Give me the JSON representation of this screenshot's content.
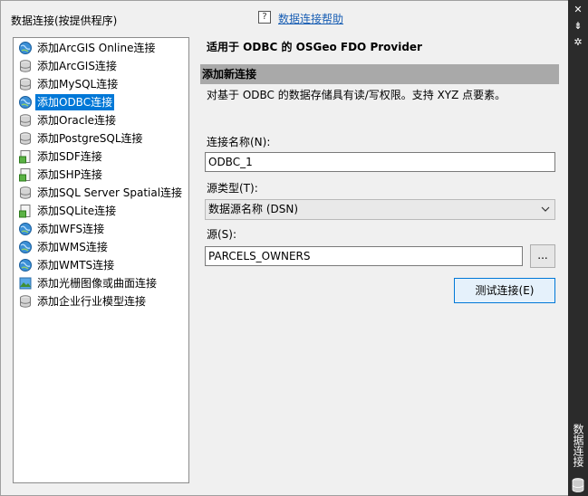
{
  "header": {
    "panel_title": "数据连接(按提供程序)",
    "help_icon": "?",
    "help_link": "数据连接帮助"
  },
  "providers": [
    {
      "label": "添加ArcGIS Online连接",
      "icon": "globe-icon"
    },
    {
      "label": "添加ArcGIS连接",
      "icon": "database-icon"
    },
    {
      "label": "添加MySQL连接",
      "icon": "database-icon"
    },
    {
      "label": "添加ODBC连接",
      "icon": "globe-icon",
      "selected": true
    },
    {
      "label": "添加Oracle连接",
      "icon": "database-icon"
    },
    {
      "label": "添加PostgreSQL连接",
      "icon": "database-icon"
    },
    {
      "label": "添加SDF连接",
      "icon": "file-icon"
    },
    {
      "label": "添加SHP连接",
      "icon": "file-icon"
    },
    {
      "label": "添加SQL Server Spatial连接",
      "icon": "database-icon"
    },
    {
      "label": "添加SQLite连接",
      "icon": "file-icon"
    },
    {
      "label": "添加WFS连接",
      "icon": "globe-icon"
    },
    {
      "label": "添加WMS连接",
      "icon": "globe-icon"
    },
    {
      "label": "添加WMTS连接",
      "icon": "globe-icon"
    },
    {
      "label": "添加光栅图像或曲面连接",
      "icon": "raster-icon"
    },
    {
      "label": "添加企业行业模型连接",
      "icon": "database-icon"
    }
  ],
  "form": {
    "provider_heading": "适用于 ODBC 的 OSGeo FDO Provider",
    "section_title": "添加新连接",
    "section_desc": "对基于 ODBC 的数据存储具有读/写权限。支持 XYZ 点要素。",
    "connection_name_label": "连接名称(N):",
    "connection_name_value": "ODBC_1",
    "source_type_label": "源类型(T):",
    "source_type_value": "数据源名称 (DSN)",
    "source_label": "源(S):",
    "source_value": "PARCELS_OWNERS",
    "browse_label": "...",
    "test_button_label": "测试连接(E)"
  },
  "side_strip": {
    "title": "数据连接",
    "close_icon": "✕",
    "pin_icon": "⇟",
    "settings_icon": "✲"
  },
  "colors": {
    "selection": "#0078d7",
    "section_bar": "#a9a9a9",
    "strip_bg": "#2b2b2b",
    "link": "#1a5fb4"
  }
}
